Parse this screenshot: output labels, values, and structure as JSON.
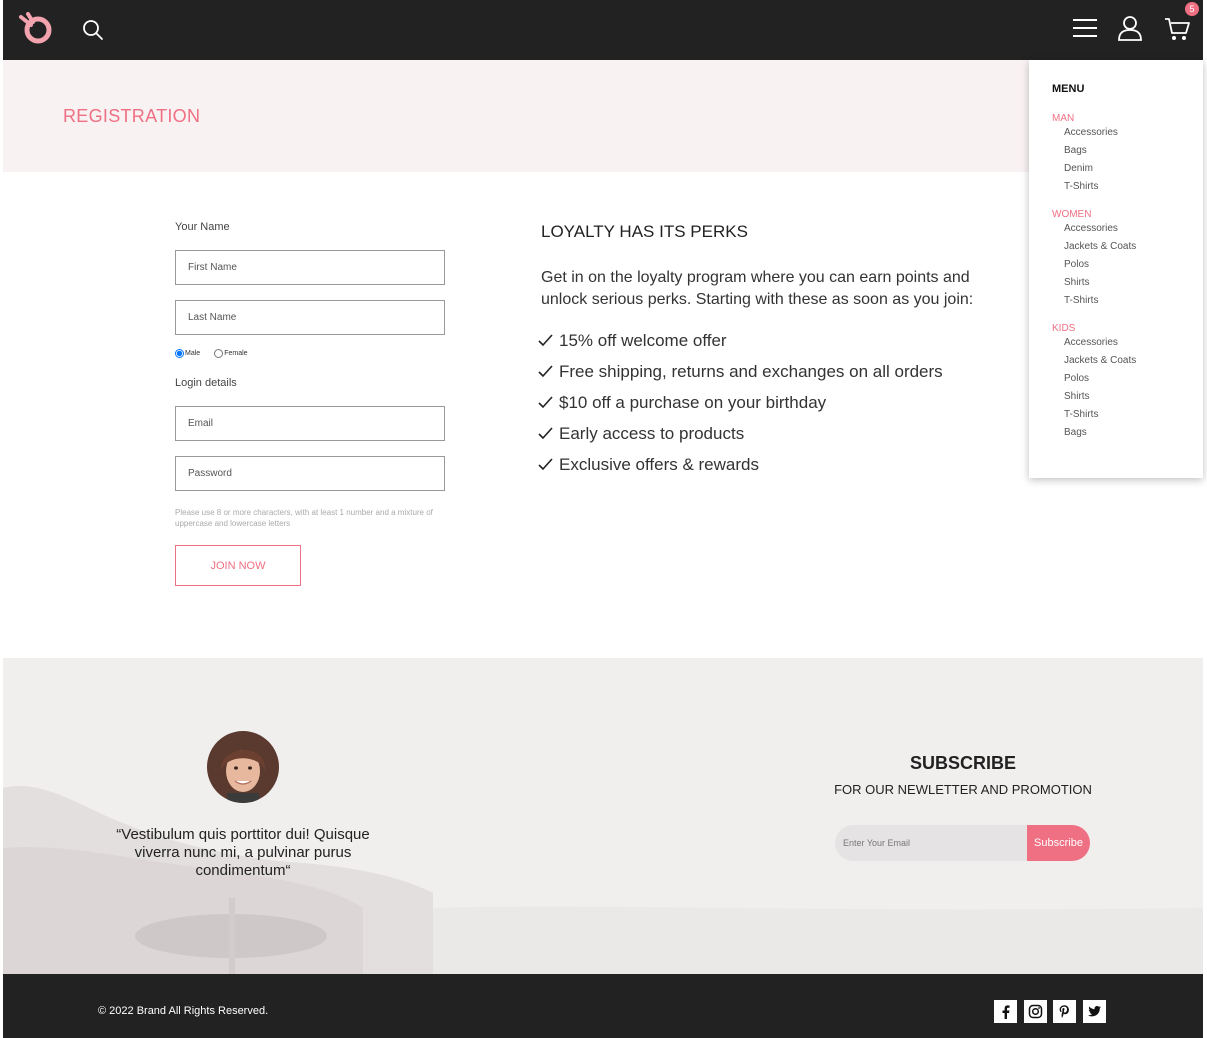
{
  "header": {
    "cart_count": "5"
  },
  "page_title": "REGISTRATION",
  "form": {
    "your_name_label": "Your Name",
    "first_name_placeholder": "First Name",
    "last_name_placeholder": "Last Name",
    "gender_options": [
      "Male",
      "Female"
    ],
    "gender_selected": "Male",
    "login_details_label": "Login details",
    "email_placeholder": "Email",
    "password_placeholder": "Password",
    "password_hint": "Please use 8 or more characters, with at least 1 number and a mixture of uppercase and lowercase letters",
    "join_button": "JOIN NOW"
  },
  "perks": {
    "title": "LOYALTY HAS ITS PERKS",
    "intro": "Get in on the loyalty program where you can earn points and unlock serious perks. Starting with these as soon as you join:",
    "items": [
      "15% off welcome offer",
      "Free shipping, returns and exchanges on all orders",
      "$10 off a purchase on your birthday",
      "Early access to products",
      "Exclusive offers & rewards"
    ]
  },
  "menu": {
    "heading": "MENU",
    "groups": [
      {
        "label": "MAN",
        "items": [
          "Accessories",
          "Bags",
          "Denim",
          "T-Shirts"
        ]
      },
      {
        "label": "WOMEN",
        "items": [
          "Accessories",
          "Jackets & Coats",
          "Polos",
          "Shirts",
          "T-Shirts"
        ]
      },
      {
        "label": "KIDS",
        "items": [
          "Accessories",
          "Jackets & Coats",
          "Polos",
          "Shirts",
          "T-Shirts",
          "Bags"
        ]
      }
    ]
  },
  "testimonial": {
    "quote": "“Vestibulum quis porttitor dui! Quisque viverra nunc mi, a pulvinar purus condimentum“"
  },
  "subscribe": {
    "title": "SUBSCRIBE",
    "subtitle": "FOR OUR NEWLETTER AND PROMOTION",
    "input_placeholder": "Enter Your Email",
    "button": "Subscribe"
  },
  "footer": {
    "copyright": "© 2022 Brand All Rights Reserved.",
    "social_icons": [
      "facebook-icon",
      "instagram-icon",
      "pinterest-icon",
      "twitter-icon"
    ]
  },
  "colors": {
    "accent": "#ef6f83",
    "header_bg": "#222222",
    "title_band_bg": "#f9f2f3"
  }
}
